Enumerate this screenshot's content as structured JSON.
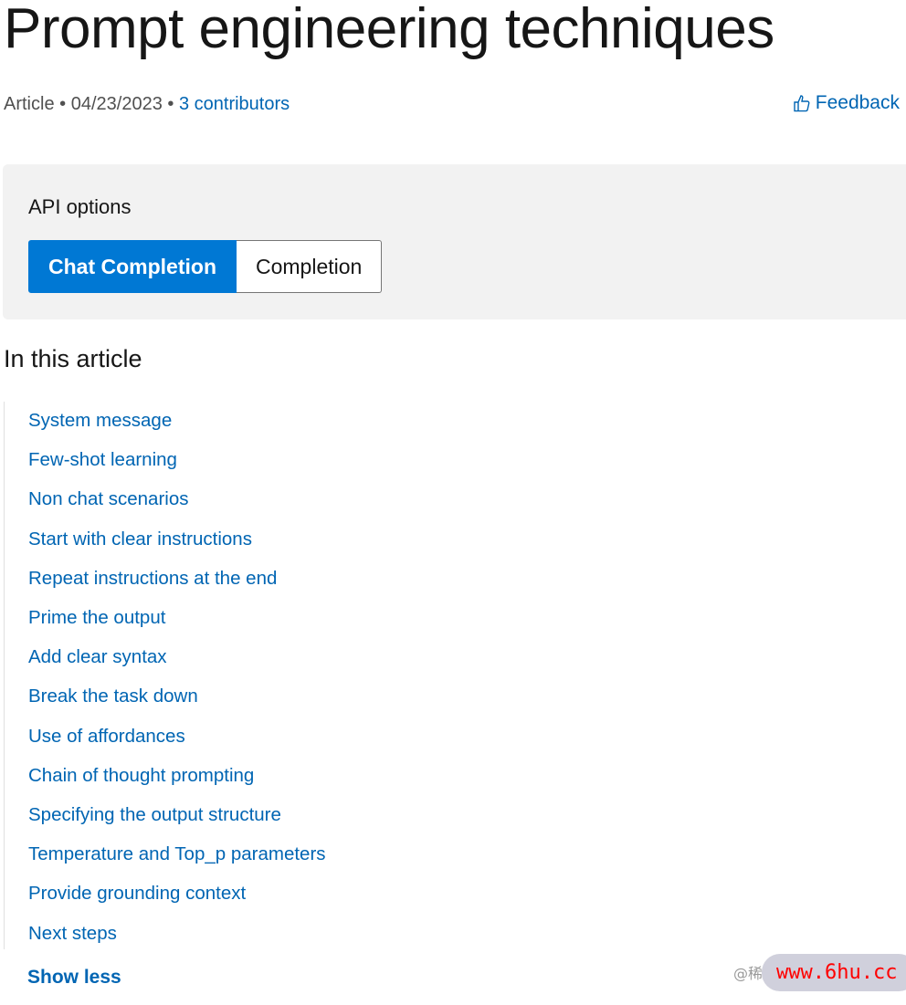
{
  "title": "Prompt engineering techniques",
  "meta": {
    "type": "Article",
    "separator": "•",
    "date": "04/23/2023",
    "contributors": "3 contributors"
  },
  "feedback": {
    "label": "Feedback",
    "icon": "thumbs-up-icon"
  },
  "api_options": {
    "heading": "API options",
    "tabs": [
      {
        "label": "Chat Completion",
        "selected": true
      },
      {
        "label": "Completion",
        "selected": false
      }
    ]
  },
  "toc": {
    "heading": "In this article",
    "items": [
      "System message",
      "Few-shot learning",
      "Non chat scenarios",
      "Start with clear instructions",
      "Repeat instructions at the end",
      "Prime the output",
      "Add clear syntax",
      "Break the task down",
      "Use of affordances",
      "Chain of thought prompting",
      "Specifying the output structure",
      "Temperature and Top_p parameters",
      "Provide grounding context",
      "Next steps"
    ],
    "show_less": "Show less"
  },
  "watermark": {
    "text": "@稀",
    "site": "www.6hu.cc"
  },
  "colors": {
    "accent": "#0078d4",
    "link": "#0065b3",
    "panel": "#f2f2f2"
  }
}
